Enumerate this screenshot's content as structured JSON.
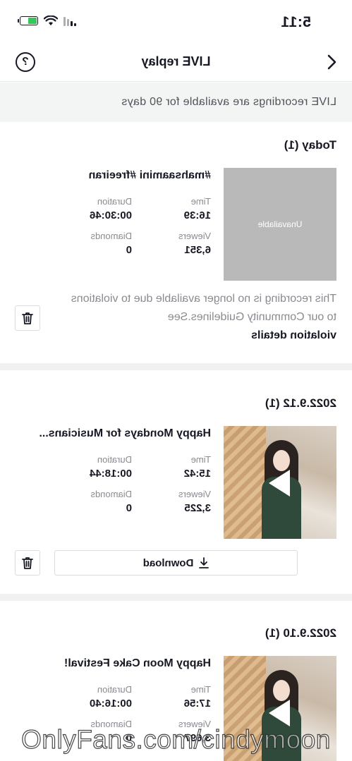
{
  "status_bar": {
    "time": "5:11"
  },
  "nav": {
    "title": "LIVE replay",
    "help_symbol": "?"
  },
  "notice": {
    "text": "LIVE recordings are available for 90 days"
  },
  "labels": {
    "time": "Time",
    "duration": "Duration",
    "viewers": "Viewers",
    "diamonds": "Diamonds"
  },
  "sections": [
    {
      "header": "Today (1)",
      "recording": {
        "title": "#mahsaamini #freeiran",
        "thumbnail_text": "Unavailable",
        "time": "16:39",
        "duration": "00:30:46",
        "viewers": "6,351",
        "diamonds": "0",
        "violation_text": "This recording is no longer available due to violations to our Community Guidelines.See",
        "violation_link": "violation details"
      }
    },
    {
      "header": "2022.9.12 (1)",
      "recording": {
        "title": "Happy Mondays for Musicians...",
        "time": "15:42",
        "duration": "00:18:44",
        "viewers": "3,225",
        "diamonds": "0",
        "download_label": "Download"
      }
    },
    {
      "header": "2022.9.10 (1)",
      "recording": {
        "title": "Happy Moon Cake Festival!",
        "time": "17:56",
        "duration": "00:16:40",
        "viewers": "3,697",
        "diamonds": "0"
      }
    }
  ],
  "watermark": "OnlyFans.com/cindymoon",
  "colors": {
    "text": "#161823",
    "muted": "#8a8b91",
    "notice_bg": "#f3f5f4",
    "battery": "#34c759"
  }
}
